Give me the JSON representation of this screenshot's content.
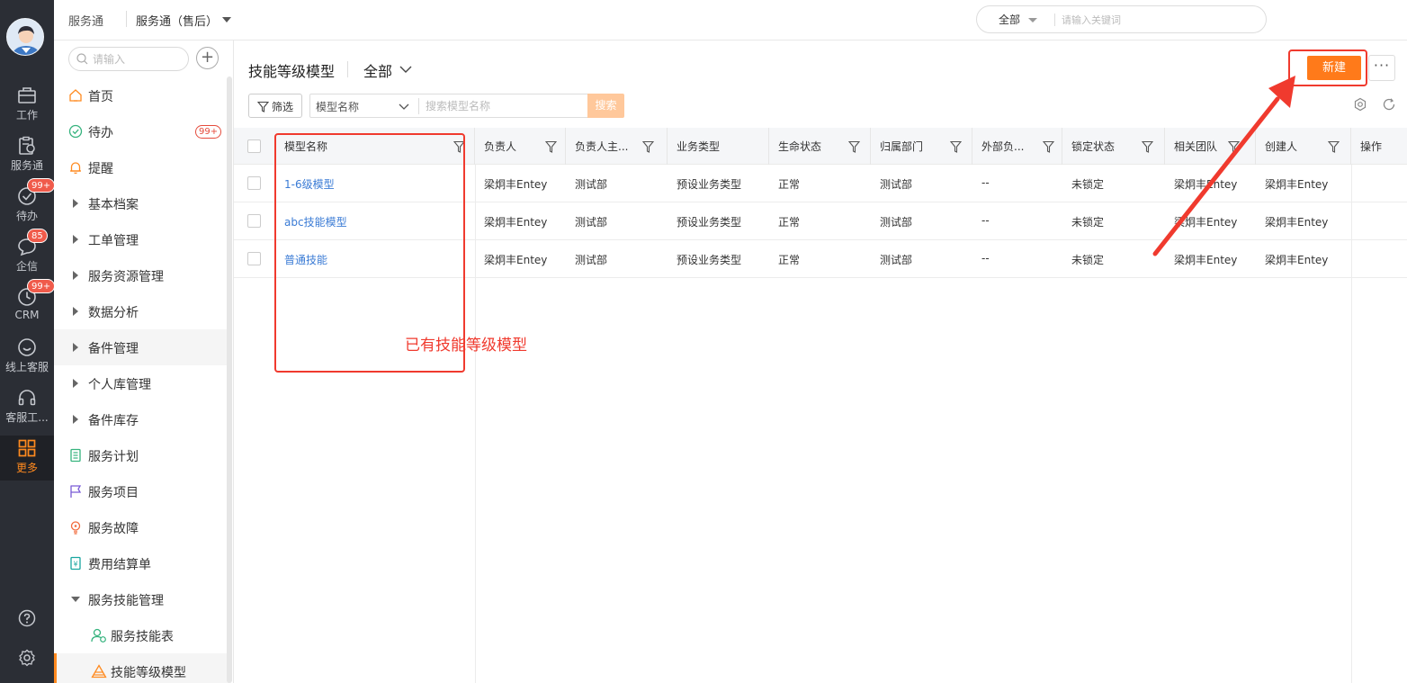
{
  "rail": {
    "items": [
      {
        "label": "工作",
        "icon": "briefcase-icon"
      },
      {
        "label": "服务通",
        "icon": "service-clipboard-icon"
      },
      {
        "label": "待办",
        "icon": "check-circle-icon",
        "badge": "99+"
      },
      {
        "label": "企信",
        "icon": "chat-bubble-icon",
        "badge": "85"
      },
      {
        "label": "CRM",
        "icon": "clock-icon",
        "badge": "99+"
      },
      {
        "label": "线上客服",
        "icon": "smile-chat-icon"
      },
      {
        "label": "客服工...",
        "icon": "headset-icon"
      },
      {
        "label": "更多",
        "icon": "grid-icon",
        "active": true
      }
    ]
  },
  "topbar": {
    "crumb1": "服务通",
    "crumb2": "服务通（售后）",
    "search_scope": "全部",
    "search_placeholder": "请输入关键词"
  },
  "menu": {
    "search_placeholder": "请输入",
    "add_label": "+",
    "items": [
      {
        "label": "首页",
        "type": "icon",
        "icon": "home-icon"
      },
      {
        "label": "待办",
        "type": "icon",
        "icon": "check-circle-icon",
        "badge": "99+"
      },
      {
        "label": "提醒",
        "type": "icon",
        "icon": "bell-icon"
      },
      {
        "label": "基本档案",
        "type": "collapsed"
      },
      {
        "label": "工单管理",
        "type": "collapsed"
      },
      {
        "label": "服务资源管理",
        "type": "collapsed"
      },
      {
        "label": "数据分析",
        "type": "collapsed"
      },
      {
        "label": "备件管理",
        "type": "collapsed",
        "hover": true
      },
      {
        "label": "个人库管理",
        "type": "collapsed"
      },
      {
        "label": "备件库存",
        "type": "collapsed"
      },
      {
        "label": "服务计划",
        "type": "icon",
        "icon": "plan-list-icon"
      },
      {
        "label": "服务项目",
        "type": "icon",
        "icon": "flag-icon"
      },
      {
        "label": "服务故障",
        "type": "icon",
        "icon": "bulb-icon"
      },
      {
        "label": "费用结算单",
        "type": "icon",
        "icon": "yuan-doc-icon"
      },
      {
        "label": "服务技能管理",
        "type": "expanded"
      },
      {
        "label": "服务技能表",
        "type": "sub",
        "icon": "user-skill-icon"
      },
      {
        "label": "技能等级模型",
        "type": "sub",
        "icon": "triangle-level-icon",
        "selected": true
      }
    ]
  },
  "main": {
    "title": "技能等级模型",
    "scope": "全部",
    "new_button": "新建",
    "more_button": "···",
    "filter_button": "筛选",
    "search_field": "模型名称",
    "search_placeholder": "搜索模型名称",
    "search_button": "搜索"
  },
  "table": {
    "columns": [
      "模型名称",
      "负责人",
      "负责人主...",
      "业务类型",
      "生命状态",
      "归属部门",
      "外部负...",
      "锁定状态",
      "相关团队",
      "创建人",
      "操作"
    ],
    "rows": [
      [
        "1-6级模型",
        "梁炯丰Entey",
        "测试部",
        "预设业务类型",
        "正常",
        "测试部",
        "--",
        "未锁定",
        "梁炯丰Entey",
        "梁炯丰Entey"
      ],
      [
        "abc技能模型",
        "梁炯丰Entey",
        "测试部",
        "预设业务类型",
        "正常",
        "测试部",
        "--",
        "未锁定",
        "梁炯丰Entey",
        "梁炯丰Entey"
      ],
      [
        "普通技能",
        "梁炯丰Entey",
        "测试部",
        "预设业务类型",
        "正常",
        "测试部",
        "--",
        "未锁定",
        "梁炯丰Entey",
        "梁炯丰Entey"
      ]
    ]
  },
  "annotation": {
    "text": "已有技能等级模型",
    "color": "#f03a2e"
  },
  "colors": {
    "accent": "#ff7a1a",
    "link": "#3a7bd5",
    "rail_bg": "#2b2e35"
  }
}
